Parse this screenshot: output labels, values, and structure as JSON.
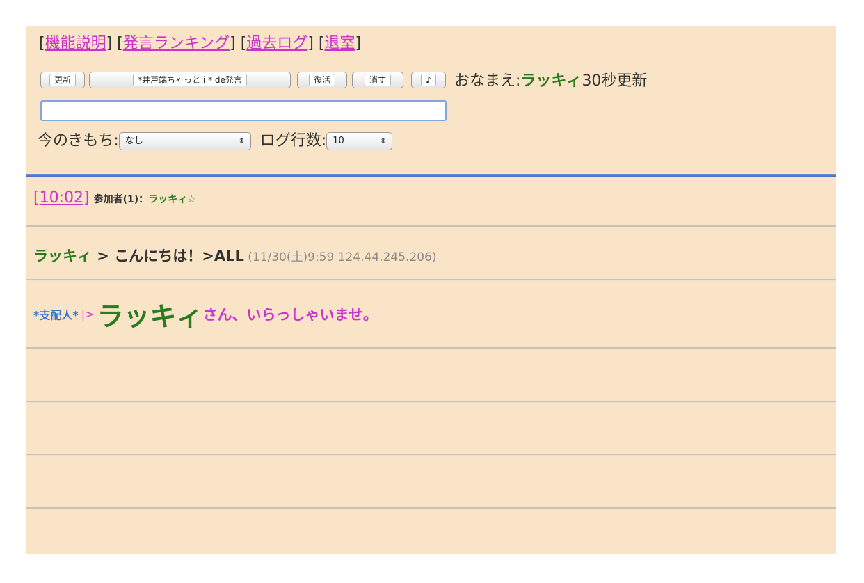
{
  "top_links": [
    {
      "label": "機能説明"
    },
    {
      "label": "発言ランキング"
    },
    {
      "label": "過去ログ"
    },
    {
      "label": "退室"
    }
  ],
  "buttons": {
    "refresh": "更新",
    "post": "*井戸端ちゃっと i * de発言",
    "restore": "復活",
    "clear": "消す",
    "sound": "♪"
  },
  "name": {
    "label": "おなまえ:",
    "value": "ラッキィ",
    "refresh_interval": "30秒更新"
  },
  "message_input": {
    "value": ""
  },
  "mood": {
    "label": "今のきもち:",
    "selected": "なし"
  },
  "log_lines": {
    "label": "ログ行数:",
    "selected": "10"
  },
  "log": {
    "time": "[10:02]",
    "participants_label": "参加者(1)：",
    "participants": "ラッキィ☆",
    "message1": {
      "user": "ラッキィ",
      "separator": " > ",
      "text": "こんにちは！>ALL",
      "meta": " (11/30(土)9:59 124.44.245.206)"
    },
    "message2": {
      "admin": "*支配人*",
      "link": "|>",
      "user": "ラッキィ",
      "text": "さん、いらっしゃいませ。"
    }
  },
  "colors": {
    "background": "#f9e4c7",
    "link": "#cc33cc",
    "name_green": "#2a7a1e",
    "admin_blue": "#3377cc",
    "divider_blue": "#4a6fcc"
  }
}
